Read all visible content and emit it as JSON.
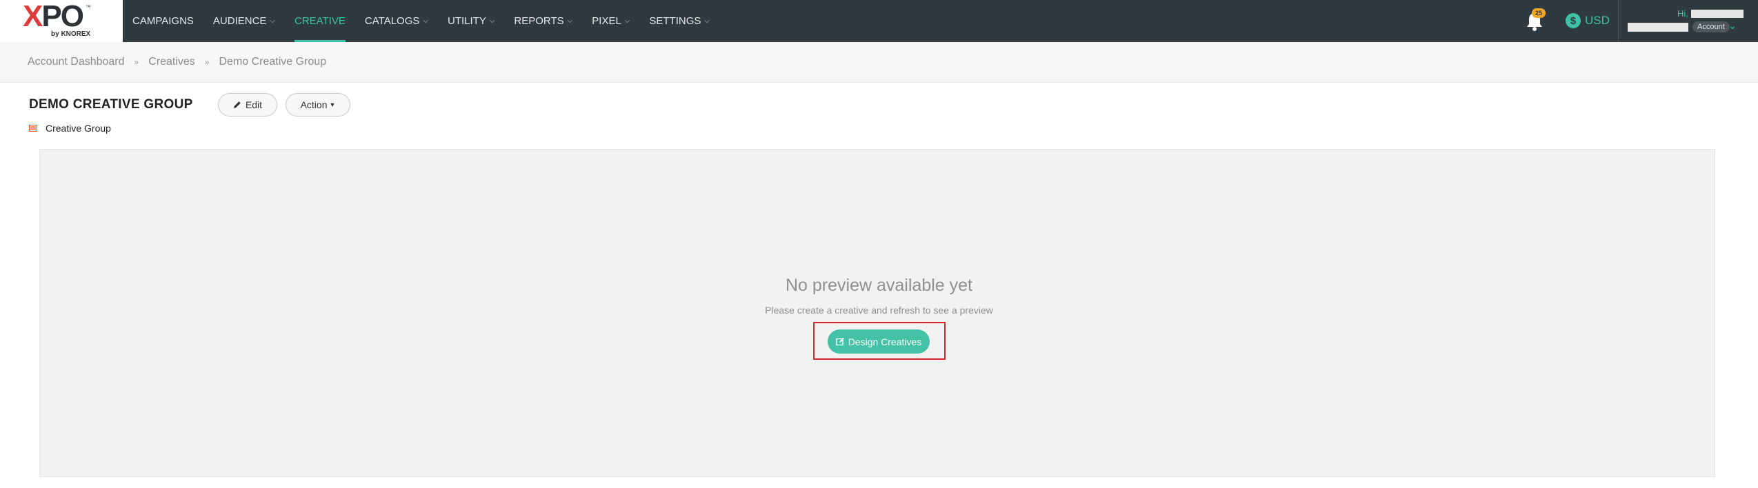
{
  "brand": {
    "logo_text": "XPO",
    "logo_sub": "by KNOREX",
    "logo_tm": "™",
    "colors": {
      "nav_bg": "#2f3a40",
      "accent": "#3fc1a5",
      "badge": "#f5a623",
      "highlight": "#d6262b"
    }
  },
  "nav": {
    "items": [
      {
        "label": "CAMPAIGNS",
        "caret": ""
      },
      {
        "label": "AUDIENCE",
        "caret": "⌄"
      },
      {
        "label": "CREATIVE",
        "caret": "",
        "active": true
      },
      {
        "label": "CATALOGS",
        "caret": "⌄"
      },
      {
        "label": "UTILITY",
        "caret": "⌄"
      },
      {
        "label": "REPORTS",
        "caret": "⌄"
      },
      {
        "label": "PIXEL",
        "caret": "⌄"
      },
      {
        "label": "SETTINGS",
        "caret": "⌄"
      }
    ]
  },
  "topright": {
    "notifications_count": "25",
    "currency_symbol": "$",
    "currency_code": "USD",
    "greeting": "Hi,",
    "account_label": "Account"
  },
  "breadcrumb": {
    "items": [
      "Account Dashboard",
      "Creatives",
      "Demo Creative Group"
    ],
    "separator": "»"
  },
  "header": {
    "title": "DEMO CREATIVE GROUP",
    "edit_label": "Edit",
    "action_label": "Action",
    "group_type": "Creative Group"
  },
  "preview": {
    "empty_title": "No preview available yet",
    "empty_subtitle": "Please create a creative and refresh to see a preview",
    "design_button": "Design Creatives"
  },
  "icons": {
    "bell": "bell-icon",
    "currency": "dollar-coin-icon",
    "edit": "pencil-icon",
    "group": "image-icon",
    "design": "edit-square-icon"
  }
}
